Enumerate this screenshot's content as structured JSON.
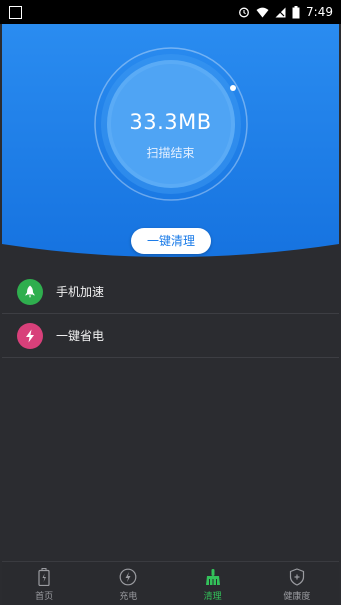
{
  "status_bar": {
    "time": "7:49"
  },
  "hero": {
    "scan_size": "33.3MB",
    "scan_status": "扫描结束",
    "clean_button_label": "一键清理",
    "accent_color": "#1a7be8"
  },
  "list": {
    "items": [
      {
        "label": "手机加速",
        "icon": "rocket-icon",
        "color": "#2fae4e"
      },
      {
        "label": "一键省电",
        "icon": "lightning-icon",
        "color": "#d8407a"
      }
    ]
  },
  "tabbar": {
    "tabs": [
      {
        "label": "首页",
        "icon": "battery-icon",
        "active": false
      },
      {
        "label": "充电",
        "icon": "charge-icon",
        "active": false
      },
      {
        "label": "清理",
        "icon": "broom-icon",
        "active": true
      },
      {
        "label": "健康度",
        "icon": "shield-icon",
        "active": false
      }
    ],
    "active_color": "#33c25a"
  }
}
